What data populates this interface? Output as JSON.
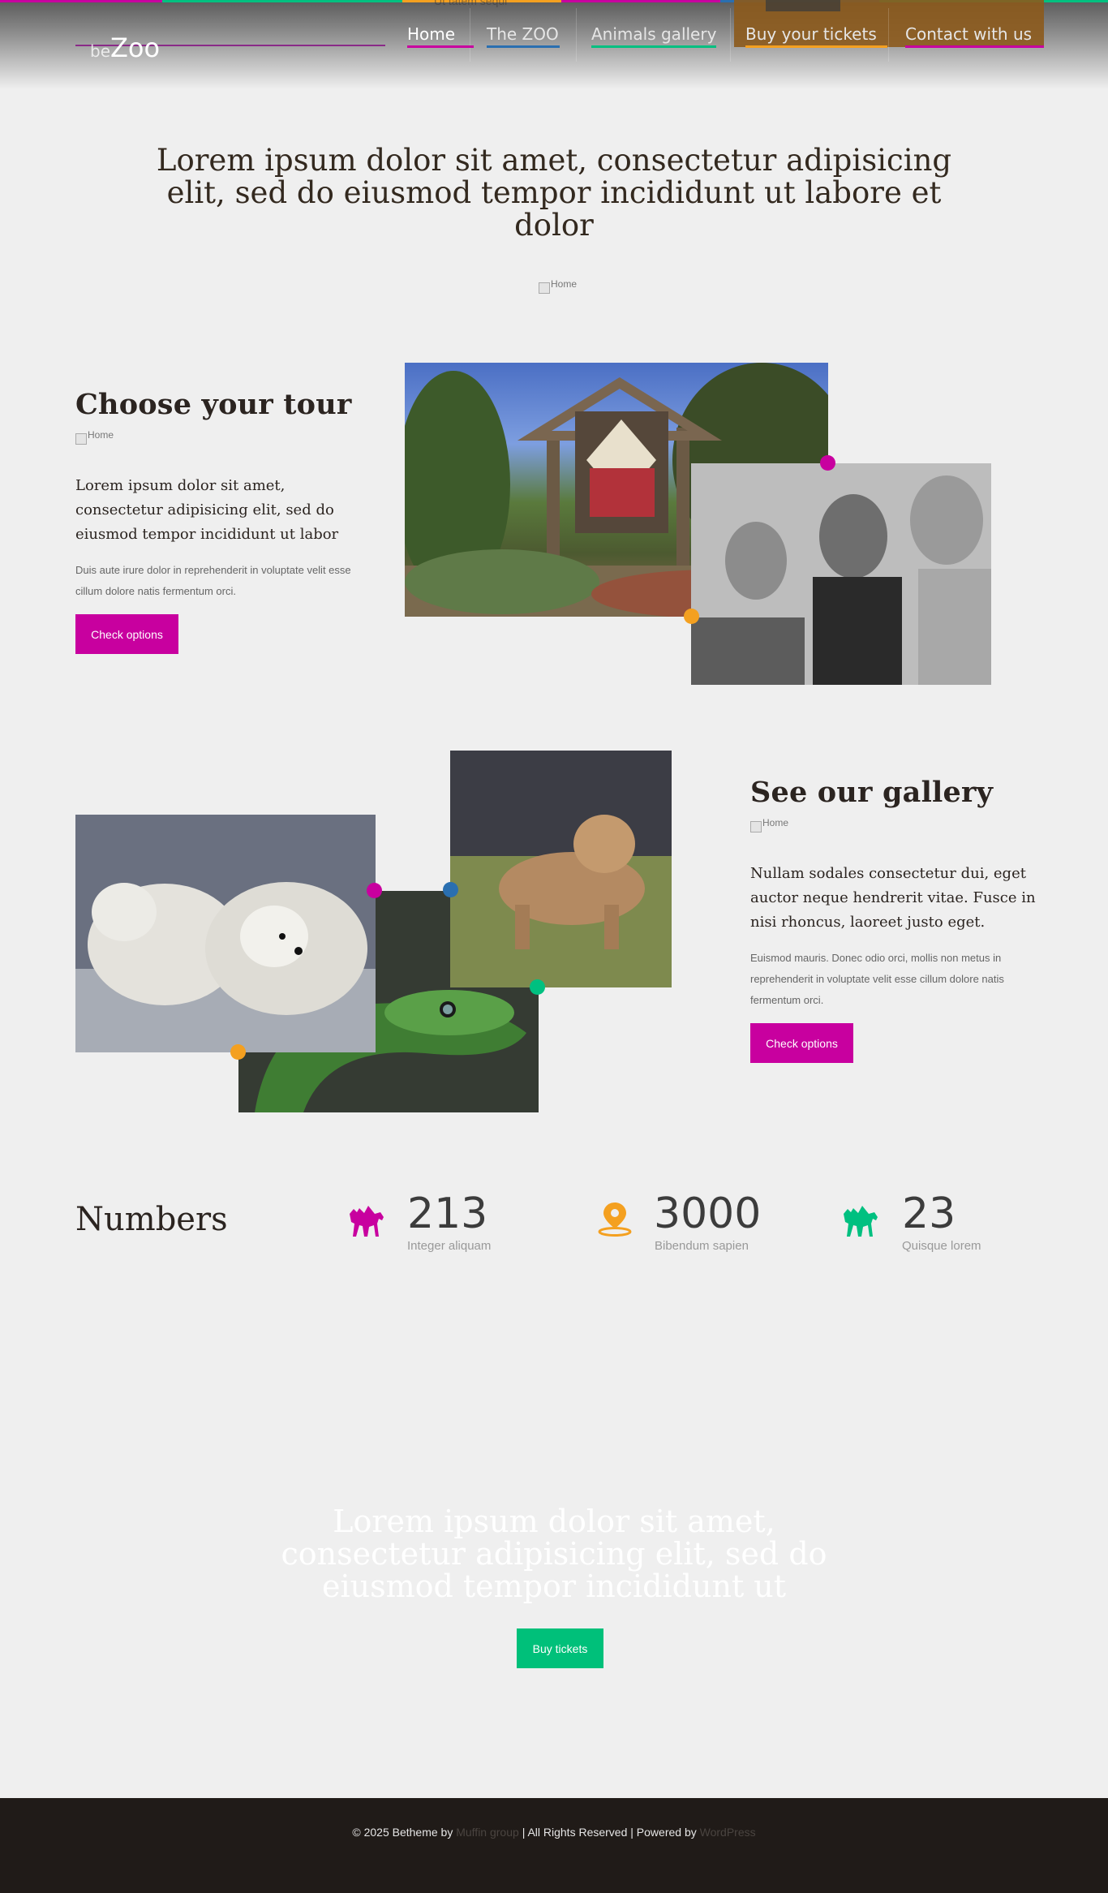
{
  "header": {
    "logo_prefix": "be",
    "logo_name": "Zoo",
    "ghost_text": "Ut tatem sequi",
    "nav": [
      "Home",
      "The ZOO",
      "Animals gallery",
      "Buy your tickets",
      "Contact with us"
    ],
    "colors": {
      "magenta": "#c8009f",
      "green": "#00c080",
      "blue": "#2a6fb0",
      "orange": "#f4a020"
    }
  },
  "hero": {
    "heading": "Lorem ipsum dolor sit amet, consectetur adipisicing elit, sed do eiusmod tempor incididunt ut labore et dolor",
    "image_alt": "Home"
  },
  "tour": {
    "title": "Choose your tour",
    "image_alt": "Home",
    "lead": "Lorem ipsum dolor sit amet, consectetur adipisicing elit, sed do eiusmod tempor incididunt ut labor",
    "text": "Duis aute irure dolor in reprehenderit in voluptate velit esse cillum dolore natis fermentum orci.",
    "button": "Check options"
  },
  "gallery": {
    "title": "See our gallery",
    "image_alt": "Home",
    "lead": "Nullam sodales consectetur dui, eget auctor neque hendrerit vitae. Fusce in nisi rhoncus, laoreet justo eget.",
    "text": "Euismod mauris. Donec odio orci, mollis non metus in reprehenderit in voluptate velit esse cillum dolore natis fermentum orci.",
    "button": "Check options"
  },
  "numbers": {
    "title": "Numbers",
    "stats": [
      {
        "value": "213",
        "label": "Integer aliquam",
        "icon": "camel-icon",
        "color": "#c8009f"
      },
      {
        "value": "3000",
        "label": "Bibendum sapien",
        "icon": "location-pin-icon",
        "color": "#f4a020"
      },
      {
        "value": "23",
        "label": "Quisque lorem",
        "icon": "camel-icon",
        "color": "#00c080"
      }
    ]
  },
  "cta": {
    "heading": "Lorem ipsum dolor sit amet, consectetur adipisicing elit, sed do eiusmod tempor incididunt ut",
    "button": "Buy tickets"
  },
  "footer": {
    "prefix": "© 2025 Betheme by",
    "link1": "Muffin group",
    "middle": "| All Rights Reserved | Powered by",
    "link2": "WordPress"
  }
}
